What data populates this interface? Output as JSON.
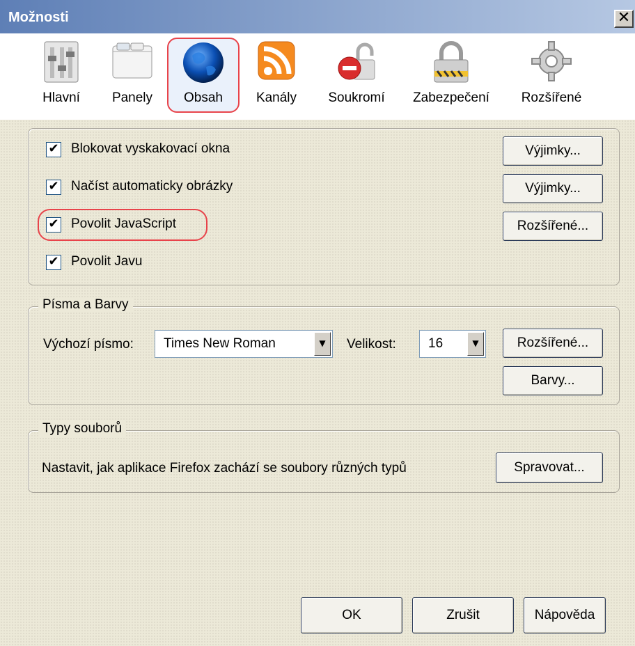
{
  "window": {
    "title": "Možnosti",
    "close_glyph": "✕"
  },
  "toolbar": {
    "items": [
      {
        "label": "Hlavní",
        "icon": "general-icon"
      },
      {
        "label": "Panely",
        "icon": "tabs-icon"
      },
      {
        "label": "Obsah",
        "icon": "globe-icon",
        "selected": true
      },
      {
        "label": "Kanály",
        "icon": "rss-icon"
      },
      {
        "label": "Soukromí",
        "icon": "privacy-icon"
      },
      {
        "label": "Zabezpečení",
        "icon": "padlock-icon"
      },
      {
        "label": "Rozšířené",
        "icon": "gear-icon"
      }
    ]
  },
  "content_group": {
    "checkboxes": [
      {
        "label": "Blokovat vyskakovací okna",
        "checked": true
      },
      {
        "label": "Načíst automaticky obrázky",
        "checked": true
      },
      {
        "label": "Povolit JavaScript",
        "checked": true
      },
      {
        "label": "Povolit Javu",
        "checked": true
      }
    ],
    "buttons": {
      "exceptions1": "Výjimky...",
      "exceptions2": "Výjimky...",
      "advanced": "Rozšířené..."
    },
    "check_glyph": "✔"
  },
  "fonts_group": {
    "legend": "Písma a Barvy",
    "default_font_label": "Výchozí písmo:",
    "default_font_value": "Times New Roman",
    "size_label": "Velikost:",
    "size_value": "16",
    "advanced_button": "Rozšířené...",
    "colors_button": "Barvy...",
    "dropdown_arrow": "▼"
  },
  "filetypes_group": {
    "legend": "Typy souborů",
    "description": "Nastavit, jak aplikace Firefox zachází se soubory různých typů",
    "manage_button": "Spravovat..."
  },
  "footer": {
    "ok": "OK",
    "cancel": "Zrušit",
    "help": "Nápověda"
  },
  "colors": {
    "highlight": "#e8434a",
    "title_gradient_start": "#5e7fb6"
  }
}
